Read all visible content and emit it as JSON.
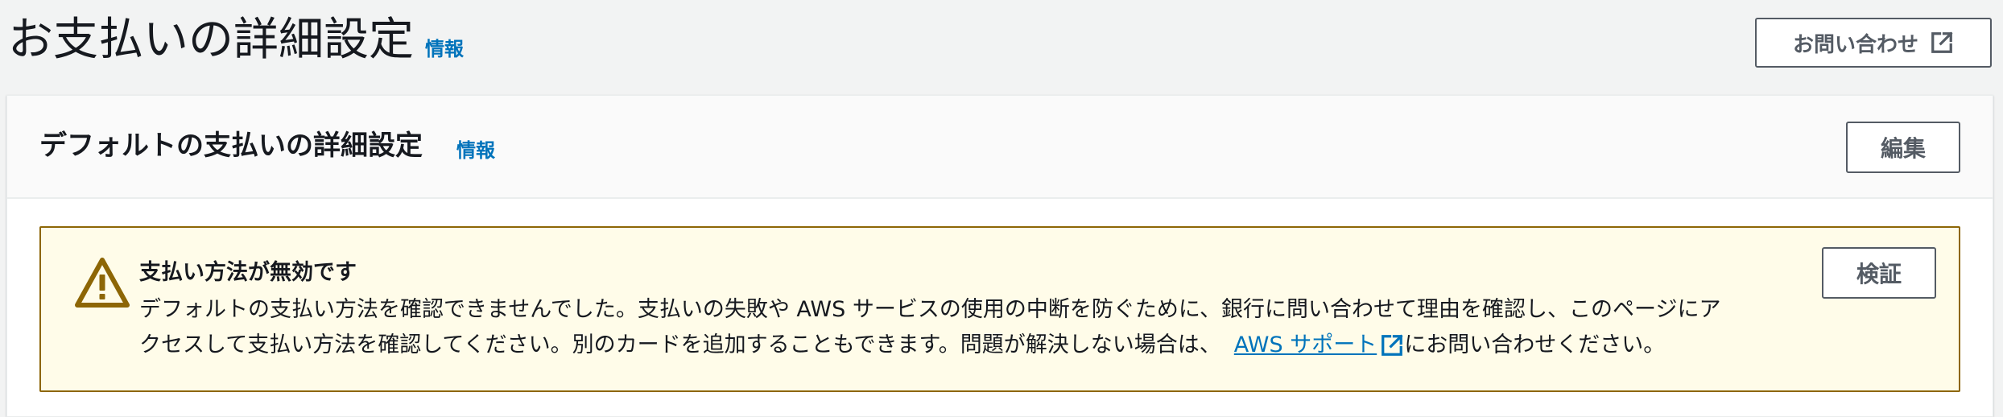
{
  "header": {
    "title": "お支払いの詳細設定",
    "info_label": "情報",
    "contact_button_label": "お問い合わせ",
    "contact_icon": "external-link-icon"
  },
  "card": {
    "title": "デフォルトの支払いの詳細設定",
    "info_label": "情報",
    "edit_button_label": "編集"
  },
  "alert": {
    "icon": "warning-icon",
    "title": "支払い方法が無効です",
    "line1": "デフォルトの支払い方法を確認できませんでした。支払いの失敗や AWS サービスの使用の中断を防ぐために、銀行に問い合わせて理由を確認し、このページにア",
    "line2_prefix": "クセスして支払い方法を確認してください。別のカードを追加することもできます。問題が解決しない場合は、",
    "support_link_label": "AWS サポート",
    "line2_suffix": "にお問い合わせください。",
    "verify_button_label": "検証"
  },
  "colors": {
    "link": "#0073bb",
    "warning": "#8d6605",
    "alert_background": "#fffce9",
    "page_background": "#f2f3f3"
  }
}
